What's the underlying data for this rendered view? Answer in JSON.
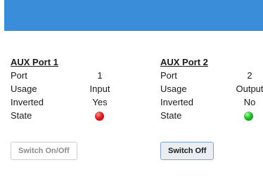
{
  "ports": [
    {
      "title": "AUX Port 1",
      "rows": [
        {
          "label": "Port",
          "value": "1"
        },
        {
          "label": "Usage",
          "value": "Input"
        },
        {
          "label": "Inverted",
          "value": "Yes"
        }
      ],
      "state_label": "State",
      "state_color": "#e41e1e",
      "button_label": "Switch On/Off"
    },
    {
      "title": "AUX Port 2",
      "rows": [
        {
          "label": "Port",
          "value": "2"
        },
        {
          "label": "Usage",
          "value": "Output"
        },
        {
          "label": "Inverted",
          "value": "No"
        }
      ],
      "state_label": "State",
      "state_color": "#22c322",
      "button_label": "Switch Off"
    }
  ],
  "colors": {
    "header": "#3a8dd8"
  }
}
